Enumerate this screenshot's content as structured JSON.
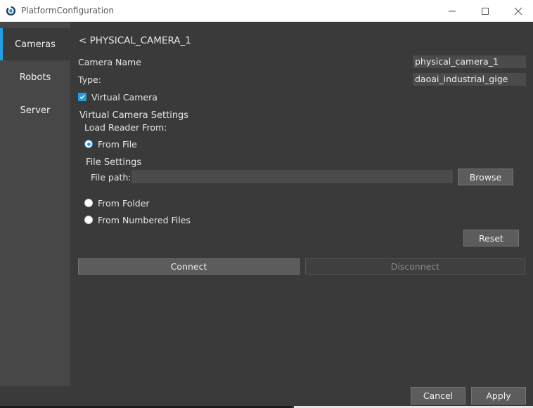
{
  "window": {
    "title": "PlatformConfiguration",
    "controls": [
      "minimize",
      "maximize",
      "close"
    ]
  },
  "sidebar": {
    "items": [
      {
        "label": "Cameras",
        "active": true
      },
      {
        "label": "Robots",
        "active": false
      },
      {
        "label": "Server",
        "active": false
      }
    ]
  },
  "camera": {
    "back_title": "< PHYSICAL_CAMERA_1",
    "name_label": "Camera Name",
    "name_value": "physical_camera_1",
    "type_label": "Type:",
    "type_value": "daoai_industrial_gige",
    "virtual_camera_label": "Virtual Camera",
    "virtual_camera_checked": true
  },
  "virtual_settings": {
    "heading": "Virtual Camera Settings",
    "load_reader_label": "Load Reader From:",
    "options": [
      {
        "label": "From File",
        "checked": true
      },
      {
        "label": "From Folder",
        "checked": false
      },
      {
        "label": "From Numbered Files",
        "checked": false
      }
    ],
    "file_settings_label": "File Settings",
    "file_path_label": "File path:",
    "file_path_value": "",
    "browse_label": "Browse",
    "reset_label": "Reset"
  },
  "actions": {
    "connect_label": "Connect",
    "disconnect_label": "Disconnect",
    "disconnect_enabled": false
  },
  "footer": {
    "cancel_label": "Cancel",
    "apply_label": "Apply"
  },
  "colors": {
    "accent": "#1ea0e8",
    "background": "#3a3a3a",
    "sidebar": "#474747"
  }
}
